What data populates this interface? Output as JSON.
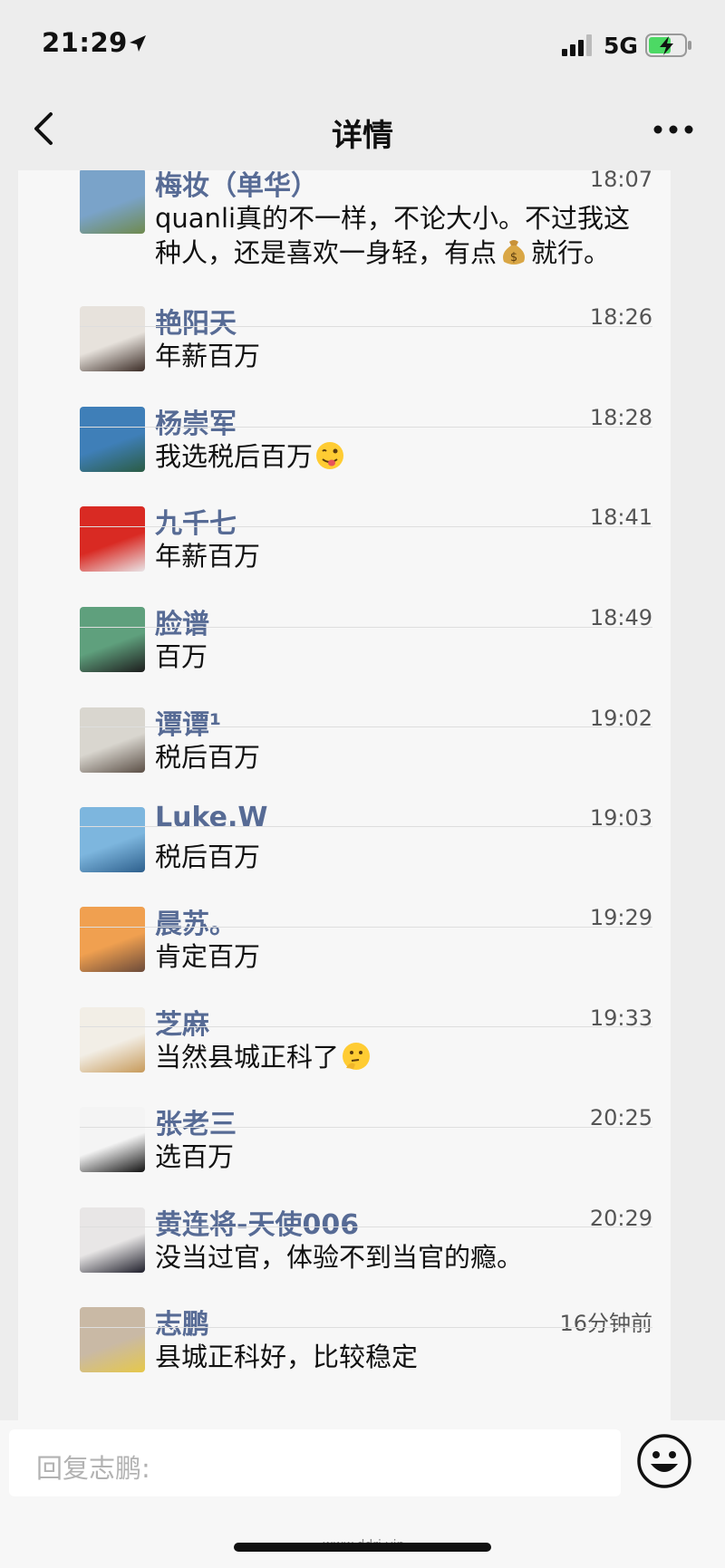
{
  "status": {
    "time": "21:29",
    "network": "5G"
  },
  "nav": {
    "title": "详情"
  },
  "comments": [
    {
      "name": "梅妆（单华）",
      "time": "18:07",
      "parts": [
        "quanli真的不一样，不论大小。不过我这种人，还是喜欢一身轻，有点",
        "就行。"
      ],
      "emoji": "money-bag-emoji",
      "avatar_colors": [
        "#7aa3c9",
        "#6f8a4e"
      ]
    },
    {
      "name": "艳阳天",
      "time": "18:26",
      "parts": [
        "年薪百万",
        ""
      ],
      "avatar_colors": [
        "#e7e2dc",
        "#3a2b25"
      ]
    },
    {
      "name": "杨崇军",
      "time": "18:28",
      "parts": [
        "我选税后百万",
        ""
      ],
      "emoji": "winking-tongue-emoji",
      "avatar_colors": [
        "#3f7fb8",
        "#2b5c44"
      ]
    },
    {
      "name": "九千七",
      "time": "18:41",
      "parts": [
        "年薪百万",
        ""
      ],
      "avatar_colors": [
        "#d92a23",
        "#e9e4e6"
      ]
    },
    {
      "name": "脸谱",
      "time": "18:49",
      "parts": [
        "百万",
        ""
      ],
      "avatar_colors": [
        "#5fa07d",
        "#1d1d1d"
      ]
    },
    {
      "name": "谭谭¹",
      "time": "19:02",
      "parts": [
        "税后百万",
        ""
      ],
      "avatar_colors": [
        "#d9d6cf",
        "#5a4e45"
      ]
    },
    {
      "name": "Luke.W",
      "time": "19:03",
      "parts": [
        "税后百万",
        ""
      ],
      "avatar_colors": [
        "#7db6de",
        "#2d5f8c"
      ]
    },
    {
      "name": "晨苏。",
      "time": "19:29",
      "parts": [
        "肯定百万",
        ""
      ],
      "avatar_colors": [
        "#f0a050",
        "#6b4a3a"
      ]
    },
    {
      "name": "芝麻",
      "time": "19:33",
      "parts": [
        "当然县城正科了",
        ""
      ],
      "emoji": "thinking-emoji",
      "avatar_colors": [
        "#f2eee6",
        "#c79a5a"
      ]
    },
    {
      "name": "张老三",
      "time": "20:25",
      "parts": [
        "选百万",
        ""
      ],
      "avatar_colors": [
        "#f4f4f4",
        "#111111"
      ]
    },
    {
      "name": "黄连将-天使006",
      "time": "20:29",
      "parts": [
        "没当过官，体验不到当官的瘾。",
        ""
      ],
      "avatar_colors": [
        "#e8e6e6",
        "#1e1e2a"
      ]
    },
    {
      "name": "志鹏",
      "time": "16分钟前",
      "parts": [
        "县城正科好，比较稳定",
        ""
      ],
      "avatar_colors": [
        "#c9b9a5",
        "#e6c84a"
      ]
    }
  ],
  "reply": {
    "placeholder": "回复志鹏:"
  },
  "watermark": "www.ddrj.vip",
  "colors": {
    "name": "#576b95",
    "background": "#ededed",
    "panel": "#f7f7f7"
  }
}
